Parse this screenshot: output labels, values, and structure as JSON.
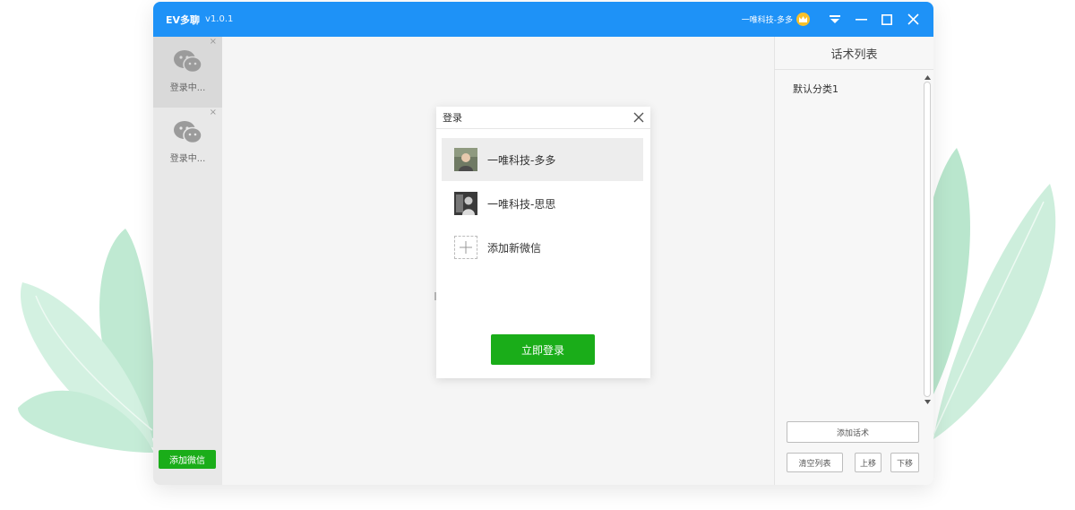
{
  "window": {
    "app_name": "EV多聊",
    "version": "v1.0.1",
    "current_user": "一唯科技-多多"
  },
  "sidebar": {
    "accounts": [
      {
        "status": "登录中..."
      },
      {
        "status": "登录中..."
      }
    ],
    "close_glyph": "×",
    "add_button": "添加微信"
  },
  "dialog": {
    "title": "登录",
    "accounts": [
      {
        "name": "一唯科技-多多"
      },
      {
        "name": "一唯科技-思思"
      }
    ],
    "add_new": "添加新微信",
    "login_button": "立即登录"
  },
  "right_panel": {
    "title": "话术列表",
    "categories": [
      "默认分类1"
    ],
    "add_button": "添加话术",
    "clear_button": "清空列表",
    "move_up_button": "上移",
    "move_down_button": "下移"
  },
  "colors": {
    "titlebar": "#1e92f7",
    "accent_green": "#1aad19",
    "crown": "#f8c12a"
  }
}
